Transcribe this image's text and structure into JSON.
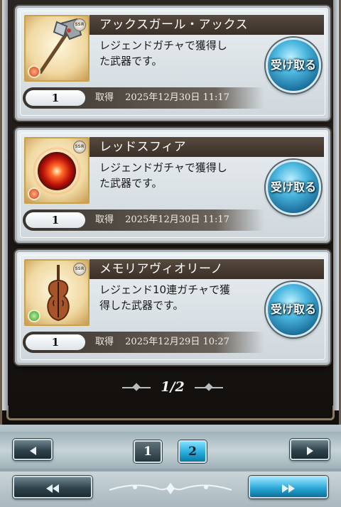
{
  "cards": [
    {
      "title": "アックスガール・アックス",
      "desc_line1": "レジェンドガチャで獲得し",
      "desc_line2": "た武器です。",
      "claim_label": "受け取る",
      "quantity": "1",
      "acquired_label": "取得",
      "acquired_date": "2025年12月30日 11:17",
      "rarity_badge": "SSR",
      "element": "fire",
      "thumbnail_icon": "axe-icon"
    },
    {
      "title": "レッドスフィア",
      "desc_line1": "レジェンドガチャで獲得し",
      "desc_line2": "た武器です。",
      "claim_label": "受け取る",
      "quantity": "1",
      "acquired_label": "取得",
      "acquired_date": "2025年12月30日 11:17",
      "rarity_badge": "SSR",
      "element": "fire",
      "thumbnail_icon": "red-orb-icon"
    },
    {
      "title": "メモリアヴィオリーノ",
      "desc_line1": "レジェンド10連ガチャで獲",
      "desc_line2": "得した武器です。",
      "claim_label": "受け取る",
      "quantity": "1",
      "acquired_label": "取得",
      "acquired_date": "2025年12月29日 10:27",
      "rarity_badge": "SSR",
      "element": "wind",
      "thumbnail_icon": "violin-icon"
    }
  ],
  "pagination": {
    "indicator": "1/2",
    "pages": [
      "1",
      "2"
    ],
    "active_page": "2",
    "prev_icon": "arrow-left-icon",
    "next_icon": "arrow-right-icon",
    "first_icon": "double-arrow-left-icon",
    "last_icon": "double-arrow-right-icon"
  },
  "colors": {
    "accent_blue": "#2aa8d8",
    "title_bar": "#4a3d33",
    "panel_dark": "#1a1714"
  }
}
